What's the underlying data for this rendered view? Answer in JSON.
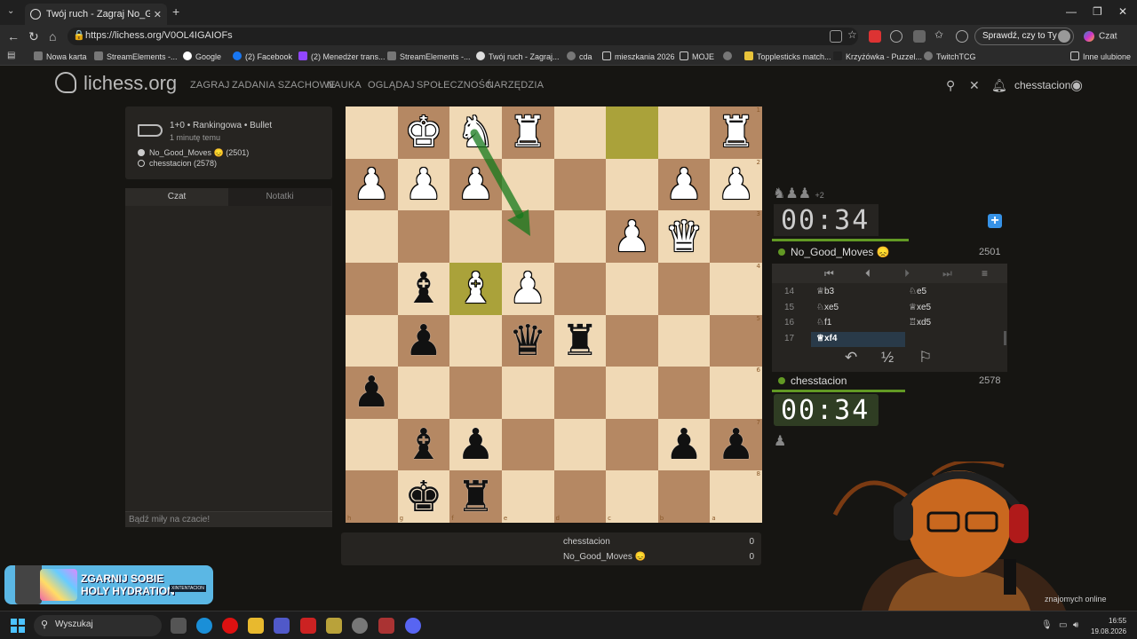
{
  "browser": {
    "tab_title": "Twój ruch - Zagraj No_Good_Mov",
    "url": "https://lichess.org/V0OL4IGAIOFs",
    "profile_btn": "Sprawdź, czy to Ty",
    "copilot": "Czat",
    "bookmarks": [
      "Nowa karta",
      "StreamElements -...",
      "Google",
      "(2) Facebook",
      "(2) Menedżer trans...",
      "StreamElements -...",
      "Twój ruch - Zagraj...",
      "cda",
      "mieszkania 2026",
      "MOJE",
      "Topplesticks match...",
      "Krzyżówka - Puzzel...",
      "TwitchTCG"
    ],
    "bookmarks_other": "Inne ulubione"
  },
  "site": {
    "logo": "lichess.org",
    "menu": [
      "ZAGRAJ",
      "ZADANIA SZACHOWE",
      "NAUKA",
      "OGLĄDAJ",
      "SPOŁECZNOŚĆ",
      "NARZĘDZIA"
    ],
    "user": "chesstacion"
  },
  "game": {
    "mode": "1+0 • Rankingowa • Bullet",
    "ago": "1 minutę temu",
    "player_black": "No_Good_Moves 😞 (2501)",
    "player_white": "chesstacion (2578)"
  },
  "chat": {
    "tab_chat": "Czat",
    "tab_notes": "Notatki",
    "placeholder": "Bądź miły na czacie!"
  },
  "board": {
    "rows": [
      [
        "",
        "♚",
        "♞",
        "♜",
        "",
        "",
        "",
        "♜"
      ],
      [
        "♟",
        "♟",
        "♟",
        "",
        "",
        "",
        "♟",
        "♟"
      ],
      [
        "",
        "",
        "",
        "",
        "",
        "♟",
        "♛",
        ""
      ],
      [
        "",
        "♝",
        "♝",
        "♟",
        "",
        "",
        "",
        ""
      ],
      [
        "",
        "♟",
        "",
        "♛",
        "♜",
        "",
        "",
        ""
      ],
      [
        "♟",
        "",
        "",
        "",
        "",
        "",
        "",
        ""
      ],
      [
        "",
        "♝",
        "♟",
        "",
        "",
        "",
        "♟",
        "♟"
      ],
      [
        "",
        "♚",
        "♜",
        "",
        "",
        "",
        "",
        ""
      ]
    ],
    "colors": [
      [
        "",
        "w",
        "w",
        "w",
        "",
        "",
        "",
        "w"
      ],
      [
        "w",
        "w",
        "w",
        "",
        "",
        "",
        "w",
        "w"
      ],
      [
        "",
        "",
        "",
        "",
        "",
        "w",
        "w",
        ""
      ],
      [
        "",
        "b",
        "w",
        "w",
        "",
        "",
        "",
        ""
      ],
      [
        "",
        "b",
        "",
        "b",
        "b",
        "",
        "",
        ""
      ],
      [
        "b",
        "",
        "",
        "",
        "",
        "",
        "",
        ""
      ],
      [
        "",
        "b",
        "b",
        "",
        "",
        "",
        "b",
        "b"
      ],
      [
        "",
        "b",
        "b",
        "",
        "",
        "",
        "",
        ""
      ]
    ],
    "highlight": [
      [
        0,
        5
      ],
      [
        3,
        2
      ]
    ],
    "rank_labels": [
      "1",
      "2",
      "3",
      "4",
      "5",
      "6",
      "7",
      "8"
    ],
    "file_labels": [
      "h",
      "g",
      "f",
      "e",
      "d",
      "c",
      "b",
      "a"
    ]
  },
  "score": {
    "rows": [
      {
        "name": "chesstacion",
        "value": "0"
      },
      {
        "name": "No_Good_Moves 😞",
        "value": "0"
      }
    ]
  },
  "right": {
    "material_extra": "+2",
    "clock_top": "00:34",
    "clock_bottom": "00:34",
    "opponent": {
      "name": "No_Good_Moves 😞",
      "rating": "2501"
    },
    "me": {
      "name": "chesstacion",
      "rating": "2578"
    },
    "moves": [
      {
        "n": "14",
        "w": "♕b3",
        "b": "♘e5"
      },
      {
        "n": "15",
        "w": "♘xe5",
        "b": "♕xe5"
      },
      {
        "n": "16",
        "w": "♘f1",
        "b": "♖xd5"
      },
      {
        "n": "17",
        "w": "♕xf4",
        "b": ""
      }
    ],
    "draw_label": "½"
  },
  "promo": {
    "line1": "ZGARNIJ SOBIE",
    "line2": "HOLY HYDRATION",
    "tag": "XINTENTACION"
  },
  "taskbar": {
    "search": "Wyszukaj",
    "time": "16:55",
    "date": "19.08.2026",
    "friends": "znajomych online"
  },
  "icons": [
    "search-icon",
    "bell-icon",
    "close-icon",
    "user-icon",
    "bullet-icon",
    "flag-icon",
    "takeback-icon",
    "menu-icon",
    "pawn-icon",
    "knight-icon"
  ]
}
